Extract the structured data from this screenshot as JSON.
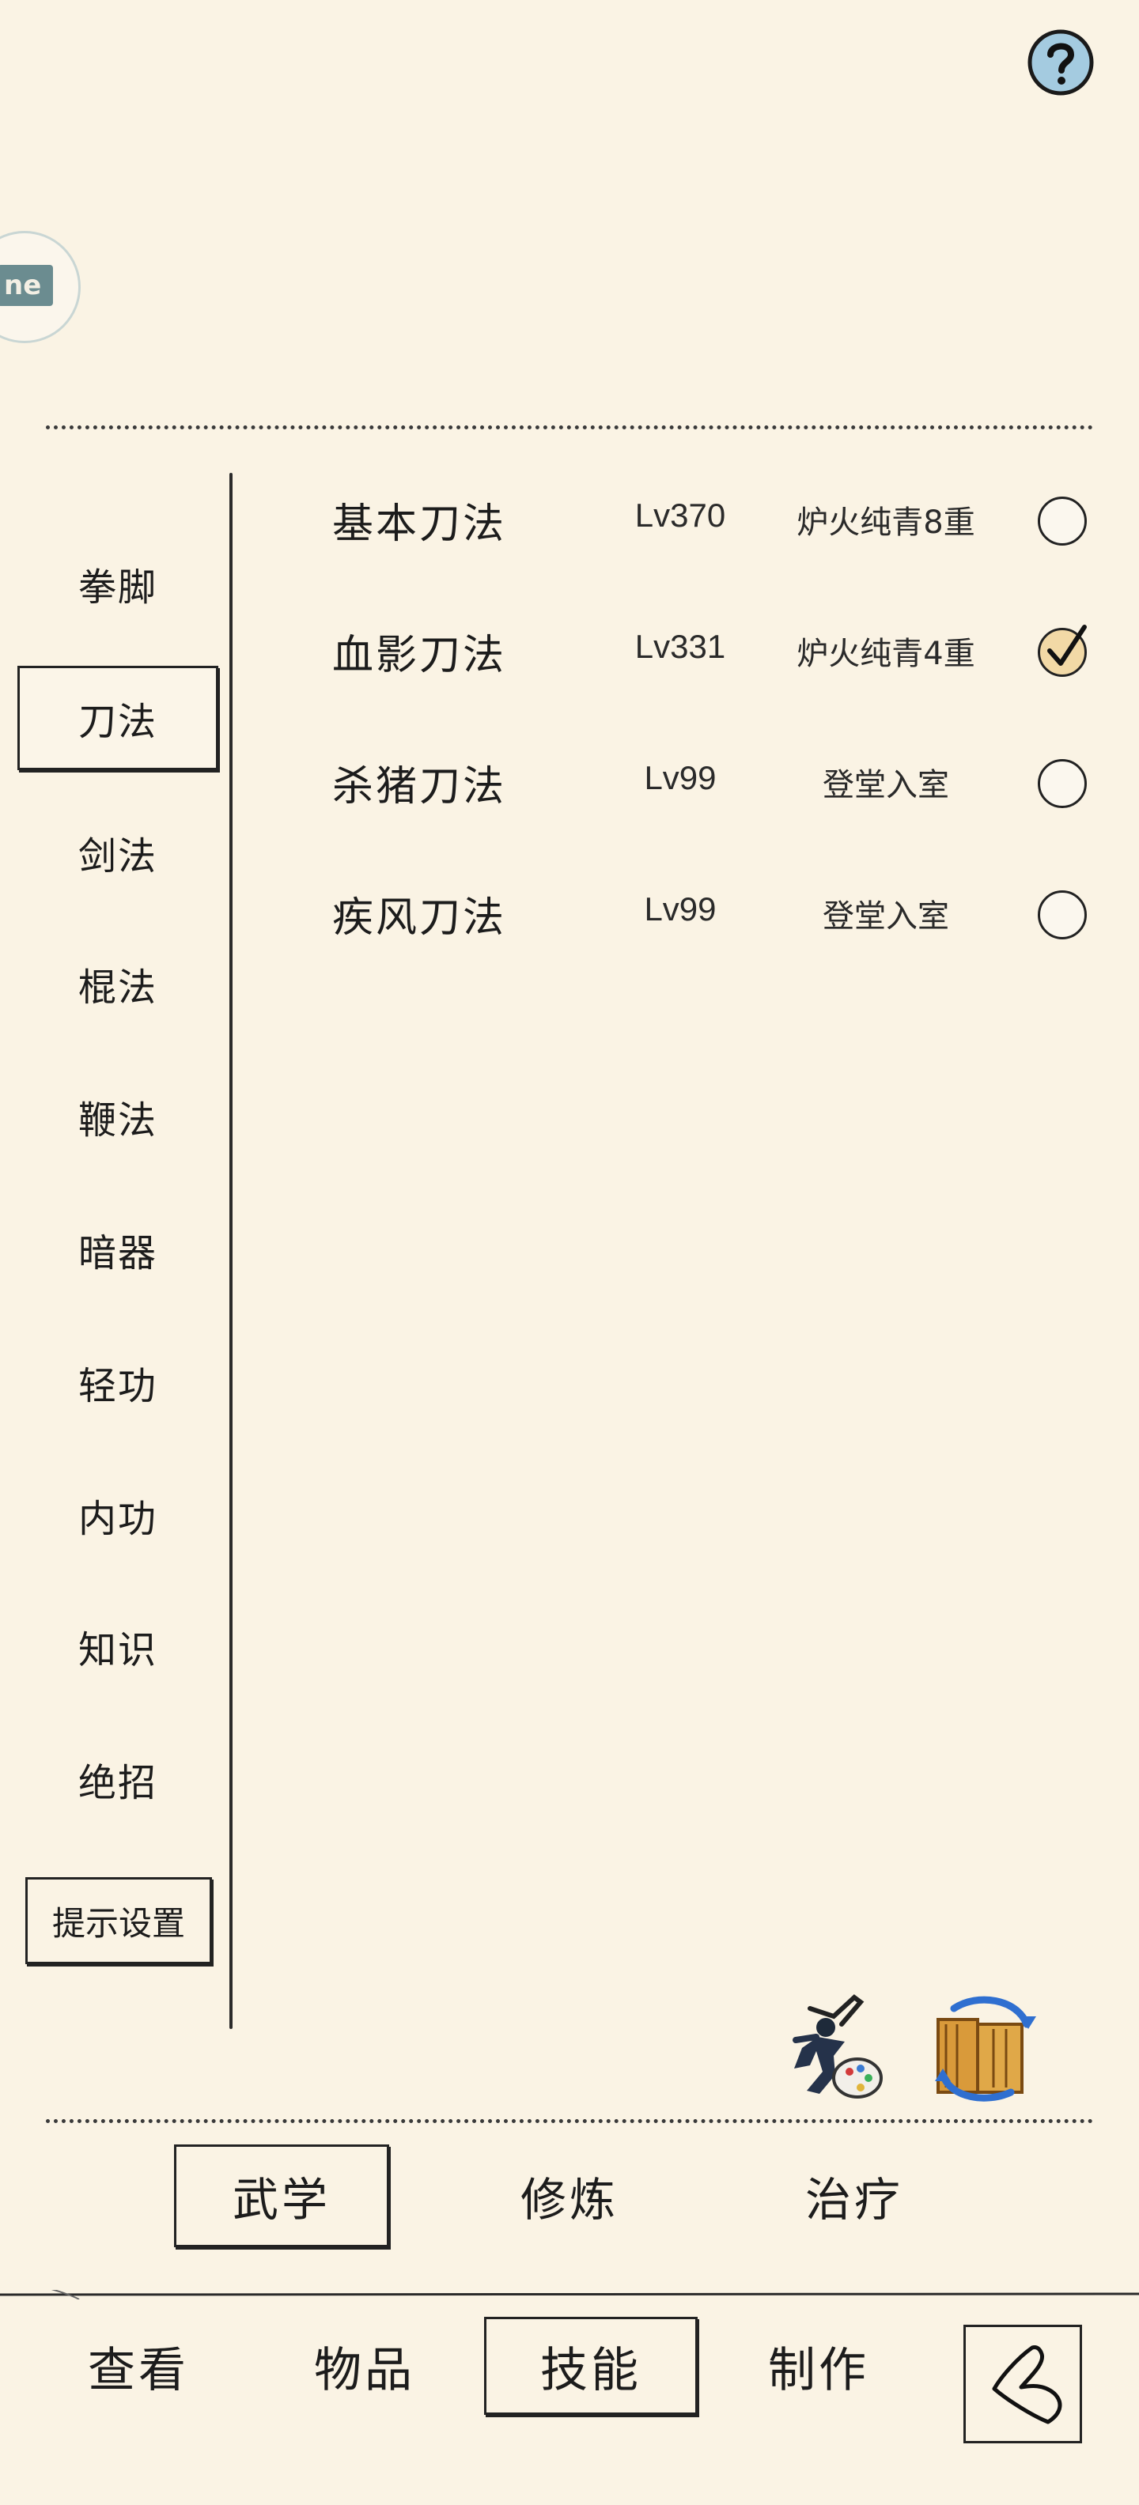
{
  "categories": [
    "拳脚",
    "刀法",
    "剑法",
    "棍法",
    "鞭法",
    "暗器",
    "轻功",
    "内功",
    "知识",
    "绝招"
  ],
  "active_category": "刀法",
  "tip_settings_label": "提示设置",
  "skills": [
    {
      "name": "基本刀法",
      "level": "Lv370",
      "rank": "炉火纯青8重",
      "selected": false
    },
    {
      "name": "血影刀法",
      "level": "Lv331",
      "rank": "炉火纯青4重",
      "selected": true
    },
    {
      "name": "杀猪刀法",
      "level": "Lv99",
      "rank": "登堂入室",
      "selected": false
    },
    {
      "name": "疾风刀法",
      "level": "Lv99",
      "rank": "登堂入室",
      "selected": false
    }
  ],
  "sub_tabs": [
    "武学",
    "修炼",
    "治疗"
  ],
  "active_sub_tab": "武学",
  "nav": [
    "查看",
    "物品",
    "技能",
    "制作"
  ],
  "active_nav": "技能",
  "avatar_text": "ne",
  "icons": {
    "help": "question-mark-icon",
    "martial-artist": "martial-artist-palette-icon",
    "scroll-swap": "scroll-swap-icon",
    "back": "back-arrow-icon"
  },
  "colors": {
    "background": "#faf3e4",
    "ink": "#1c1c1c",
    "help_blue": "#9fc7dd",
    "checked_fill": "#f2d9a6"
  }
}
